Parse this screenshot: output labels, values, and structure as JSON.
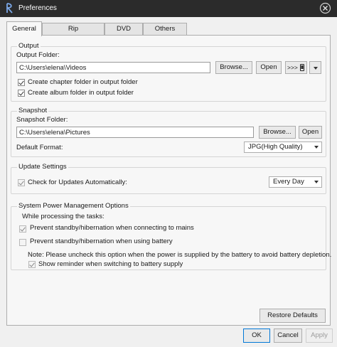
{
  "window": {
    "title": "Preferences"
  },
  "tabs": [
    {
      "label": "General",
      "active": true
    },
    {
      "label": "Rip",
      "active": false
    },
    {
      "label": "DVD",
      "active": false
    },
    {
      "label": "Others",
      "active": false
    }
  ],
  "output": {
    "group_label": "Output",
    "folder_label": "Output Folder:",
    "folder_value": "C:\\Users\\elena\\Videos",
    "browse_label": "Browse...",
    "open_label": "Open",
    "device_button_label": ">>>",
    "chapter_folder_label": "Create chapter folder in output folder",
    "chapter_folder_checked": true,
    "album_folder_label": "Create album folder in output folder",
    "album_folder_checked": true
  },
  "snapshot": {
    "group_label": "Snapshot",
    "folder_label": "Snapshot Folder:",
    "folder_value": "C:\\Users\\elena\\Pictures",
    "browse_label": "Browse...",
    "open_label": "Open",
    "format_label": "Default Format:",
    "format_value": "JPG(High Quality)"
  },
  "update": {
    "group_label": "Update Settings",
    "check_label": "Check for Updates Automatically:",
    "check_checked": true,
    "frequency_value": "Every Day"
  },
  "power": {
    "group_label": "System Power Management Options",
    "while_label": "While processing the tasks:",
    "mains_label": "Prevent standby/hibernation when connecting to mains",
    "mains_checked": true,
    "battery_label": "Prevent standby/hibernation when using battery",
    "battery_checked": false,
    "note_label": "Note: Please uncheck this option when the power is supplied by the battery to avoid battery depletion.",
    "reminder_label": "Show reminder when switching to battery supply",
    "reminder_checked": true
  },
  "footer": {
    "restore_label": "Restore Defaults",
    "ok_label": "OK",
    "cancel_label": "Cancel",
    "apply_label": "Apply"
  },
  "colors": {
    "titlebar": "#2b2b2b",
    "panel": "#f7f7f7",
    "accent": "#0078d7"
  },
  "icons": {
    "app": "app-logo-icon",
    "close": "close-icon",
    "device": "phone-icon"
  }
}
